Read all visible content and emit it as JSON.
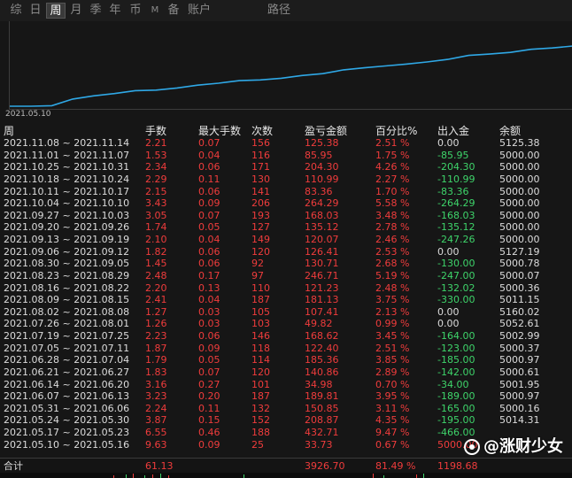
{
  "tabs": [
    {
      "label": "综",
      "active": false
    },
    {
      "label": "日",
      "active": false
    },
    {
      "label": "周",
      "active": true
    },
    {
      "label": "月",
      "active": false
    },
    {
      "label": "季",
      "active": false
    },
    {
      "label": "年",
      "active": false
    },
    {
      "label": "币",
      "active": false
    },
    {
      "label": "M",
      "active": false
    },
    {
      "label": "备",
      "active": false
    },
    {
      "label": "账户",
      "active": false
    },
    {
      "label": "路径",
      "active": false
    }
  ],
  "chart": {
    "start_label": "2021.05.10",
    "line_color": "#2fa8e6"
  },
  "columns": [
    "周",
    "手数",
    "最大手数",
    "次数",
    "盈亏金额",
    "百分比%",
    "出入金",
    "余额"
  ],
  "rows": [
    {
      "week": "2021.11.08 ~ 2021.11.14",
      "lots": "2.21",
      "max_lots": "0.07",
      "count": "156",
      "pnl": "125.38",
      "pct": "2.51 %",
      "flow": "0.00",
      "flow_tone": "white",
      "balance": "5125.38"
    },
    {
      "week": "2021.11.01 ~ 2021.11.07",
      "lots": "1.53",
      "max_lots": "0.04",
      "count": "116",
      "pnl": "85.95",
      "pct": "1.75 %",
      "flow": "-85.95",
      "flow_tone": "green",
      "balance": "5000.00"
    },
    {
      "week": "2021.10.25 ~ 2021.10.31",
      "lots": "2.34",
      "max_lots": "0.06",
      "count": "171",
      "pnl": "204.30",
      "pct": "4.26 %",
      "flow": "-204.30",
      "flow_tone": "green",
      "balance": "5000.00"
    },
    {
      "week": "2021.10.18 ~ 2021.10.24",
      "lots": "2.29",
      "max_lots": "0.11",
      "count": "130",
      "pnl": "110.99",
      "pct": "2.27 %",
      "flow": "-110.99",
      "flow_tone": "green",
      "balance": "5000.00"
    },
    {
      "week": "2021.10.11 ~ 2021.10.17",
      "lots": "2.15",
      "max_lots": "0.06",
      "count": "141",
      "pnl": "83.36",
      "pct": "1.70 %",
      "flow": "-83.36",
      "flow_tone": "green",
      "balance": "5000.00"
    },
    {
      "week": "2021.10.04 ~ 2021.10.10",
      "lots": "3.43",
      "max_lots": "0.09",
      "count": "206",
      "pnl": "264.29",
      "pct": "5.58 %",
      "flow": "-264.29",
      "flow_tone": "green",
      "balance": "5000.00"
    },
    {
      "week": "2021.09.27 ~ 2021.10.03",
      "lots": "3.05",
      "max_lots": "0.07",
      "count": "193",
      "pnl": "168.03",
      "pct": "3.48 %",
      "flow": "-168.03",
      "flow_tone": "green",
      "balance": "5000.00"
    },
    {
      "week": "2021.09.20 ~ 2021.09.26",
      "lots": "1.74",
      "max_lots": "0.05",
      "count": "127",
      "pnl": "135.12",
      "pct": "2.78 %",
      "flow": "-135.12",
      "flow_tone": "green",
      "balance": "5000.00"
    },
    {
      "week": "2021.09.13 ~ 2021.09.19",
      "lots": "2.10",
      "max_lots": "0.04",
      "count": "149",
      "pnl": "120.07",
      "pct": "2.46 %",
      "flow": "-247.26",
      "flow_tone": "green",
      "balance": "5000.00"
    },
    {
      "week": "2021.09.06 ~ 2021.09.12",
      "lots": "1.82",
      "max_lots": "0.06",
      "count": "120",
      "pnl": "126.41",
      "pct": "2.53 %",
      "flow": "0.00",
      "flow_tone": "white",
      "balance": "5127.19"
    },
    {
      "week": "2021.08.30 ~ 2021.09.05",
      "lots": "1.45",
      "max_lots": "0.06",
      "count": "92",
      "pnl": "130.71",
      "pct": "2.68 %",
      "flow": "-130.00",
      "flow_tone": "green",
      "balance": "5000.78"
    },
    {
      "week": "2021.08.23 ~ 2021.08.29",
      "lots": "2.48",
      "max_lots": "0.17",
      "count": "97",
      "pnl": "246.71",
      "pct": "5.19 %",
      "flow": "-247.00",
      "flow_tone": "green",
      "balance": "5000.07"
    },
    {
      "week": "2021.08.16 ~ 2021.08.22",
      "lots": "2.20",
      "max_lots": "0.13",
      "count": "110",
      "pnl": "121.23",
      "pct": "2.48 %",
      "flow": "-132.02",
      "flow_tone": "green",
      "balance": "5000.36"
    },
    {
      "week": "2021.08.09 ~ 2021.08.15",
      "lots": "2.41",
      "max_lots": "0.04",
      "count": "187",
      "pnl": "181.13",
      "pct": "3.75 %",
      "flow": "-330.00",
      "flow_tone": "green",
      "balance": "5011.15"
    },
    {
      "week": "2021.08.02 ~ 2021.08.08",
      "lots": "1.27",
      "max_lots": "0.03",
      "count": "105",
      "pnl": "107.41",
      "pct": "2.13 %",
      "flow": "0.00",
      "flow_tone": "white",
      "balance": "5160.02"
    },
    {
      "week": "2021.07.26 ~ 2021.08.01",
      "lots": "1.26",
      "max_lots": "0.03",
      "count": "103",
      "pnl": "49.82",
      "pct": "0.99 %",
      "flow": "0.00",
      "flow_tone": "white",
      "balance": "5052.61"
    },
    {
      "week": "2021.07.19 ~ 2021.07.25",
      "lots": "2.23",
      "max_lots": "0.06",
      "count": "146",
      "pnl": "168.62",
      "pct": "3.45 %",
      "flow": "-164.00",
      "flow_tone": "green",
      "balance": "5002.99"
    },
    {
      "week": "2021.07.05 ~ 2021.07.11",
      "lots": "1.87",
      "max_lots": "0.09",
      "count": "118",
      "pnl": "122.40",
      "pct": "2.51 %",
      "flow": "-123.00",
      "flow_tone": "green",
      "balance": "5000.37"
    },
    {
      "week": "2021.06.28 ~ 2021.07.04",
      "lots": "1.79",
      "max_lots": "0.05",
      "count": "114",
      "pnl": "185.36",
      "pct": "3.85 %",
      "flow": "-185.00",
      "flow_tone": "green",
      "balance": "5000.97"
    },
    {
      "week": "2021.06.21 ~ 2021.06.27",
      "lots": "1.83",
      "max_lots": "0.07",
      "count": "120",
      "pnl": "140.86",
      "pct": "2.89 %",
      "flow": "-142.00",
      "flow_tone": "green",
      "balance": "5000.61"
    },
    {
      "week": "2021.06.14 ~ 2021.06.20",
      "lots": "3.16",
      "max_lots": "0.27",
      "count": "101",
      "pnl": "34.98",
      "pct": "0.70 %",
      "flow": "-34.00",
      "flow_tone": "green",
      "balance": "5001.95"
    },
    {
      "week": "2021.06.07 ~ 2021.06.13",
      "lots": "3.23",
      "max_lots": "0.20",
      "count": "187",
      "pnl": "189.81",
      "pct": "3.95 %",
      "flow": "-189.00",
      "flow_tone": "green",
      "balance": "5000.97"
    },
    {
      "week": "2021.05.31 ~ 2021.06.06",
      "lots": "2.24",
      "max_lots": "0.11",
      "count": "132",
      "pnl": "150.85",
      "pct": "3.11 %",
      "flow": "-165.00",
      "flow_tone": "green",
      "balance": "5000.16"
    },
    {
      "week": "2021.05.24 ~ 2021.05.30",
      "lots": "3.87",
      "max_lots": "0.15",
      "count": "152",
      "pnl": "208.87",
      "pct": "4.35 %",
      "flow": "-195.00",
      "flow_tone": "green",
      "balance": "5014.31"
    },
    {
      "week": "2021.05.17 ~ 2021.05.23",
      "lots": "6.55",
      "max_lots": "0.46",
      "count": "188",
      "pnl": "432.71",
      "pct": "9.47 %",
      "flow": "-466.00",
      "flow_tone": "green",
      "balance": ""
    },
    {
      "week": "2021.05.10 ~ 2021.05.16",
      "lots": "9.63",
      "max_lots": "0.09",
      "count": "25",
      "pnl": "33.73",
      "pct": "0.67 %",
      "flow": "5000.00",
      "flow_tone": "red",
      "balance": ""
    }
  ],
  "totals": {
    "label": "合计",
    "lots": "61.13",
    "pnl": "3926.70",
    "pct": "81.49 %",
    "flow": "1198.68"
  },
  "watermark": "@涨财少女",
  "colors": {
    "positive": "#f03c3c",
    "negative": "#3ed46a",
    "accent": "#2fa8e6"
  }
}
